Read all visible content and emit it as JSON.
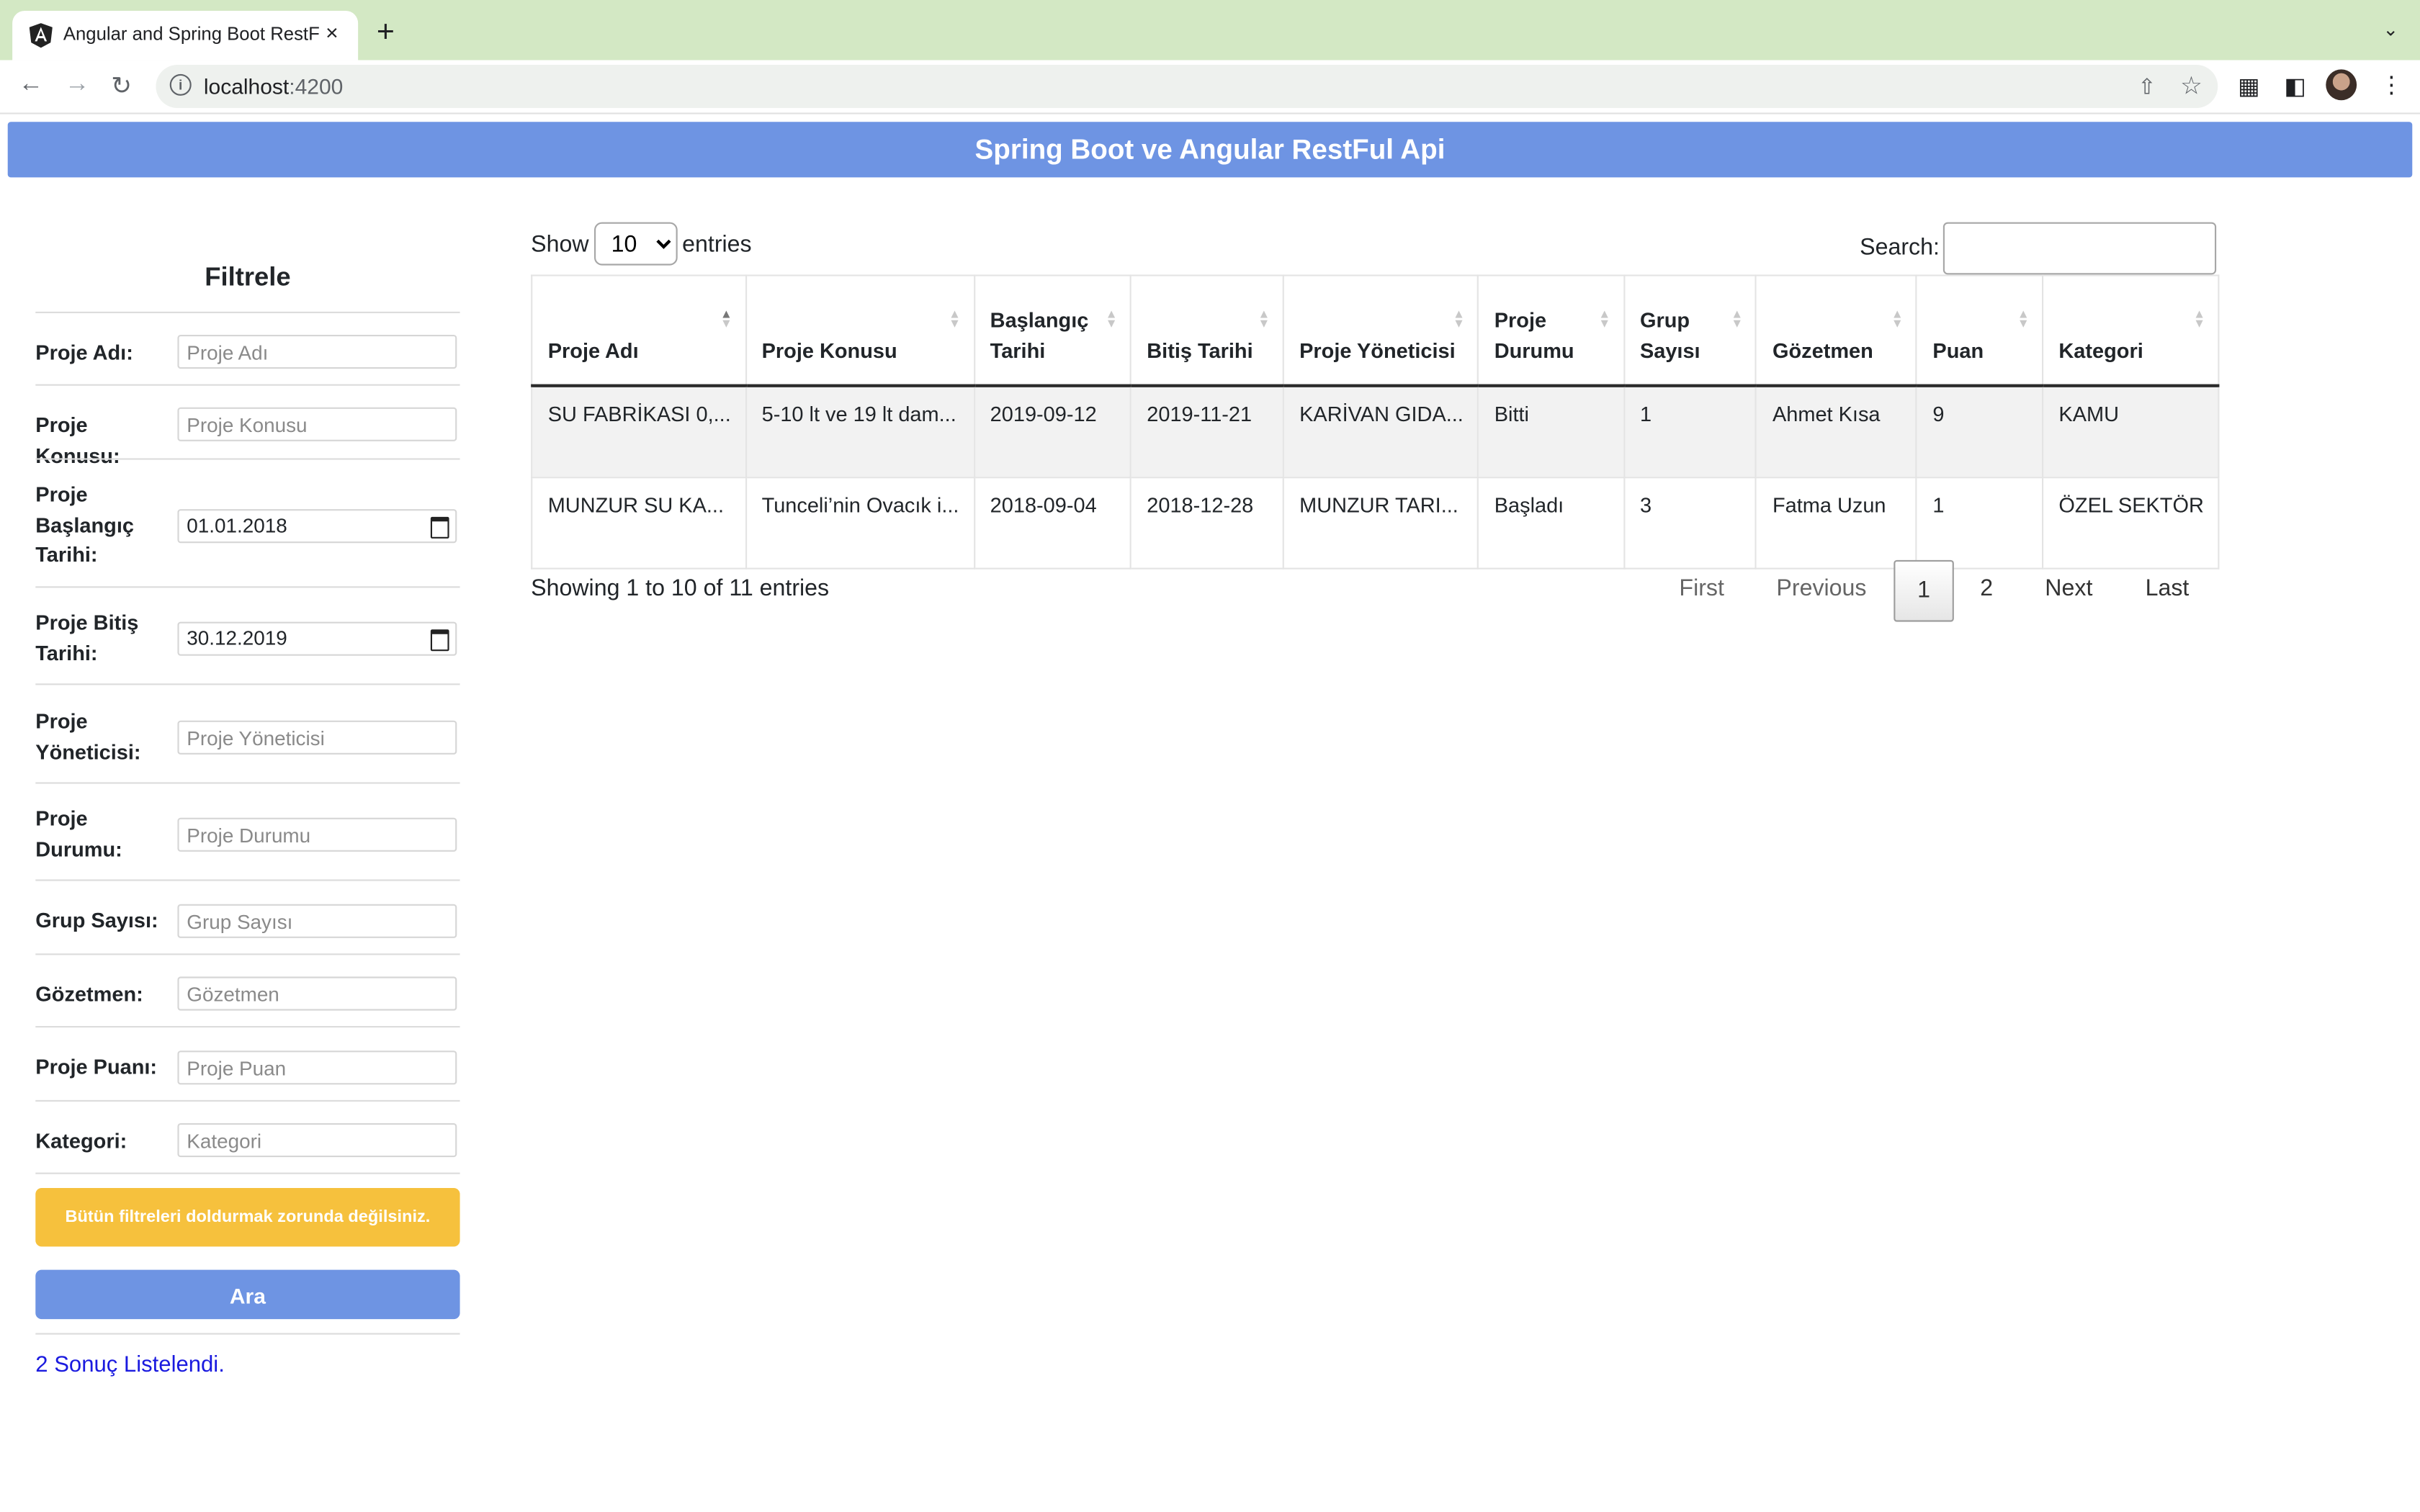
{
  "browser": {
    "tab_title": "Angular and Spring Boot RestF",
    "close_glyph": "×",
    "new_tab_glyph": "+",
    "url_host": "localhost",
    "url_port": ":4200"
  },
  "banner": {
    "title": "Spring Boot ve Angular RestFul Api"
  },
  "filter": {
    "title": "Filtrele",
    "fields": [
      {
        "label": "Proje Adı:",
        "placeholder": "Proje Adı"
      },
      {
        "label": "Proje Konusu:",
        "placeholder": "Proje Konusu"
      },
      {
        "label": "Proje Başlangıç Tarihi:",
        "value": "01.01.2018"
      },
      {
        "label": "Proje Bitiş Tarihi:",
        "value": "30.12.2019"
      },
      {
        "label": "Proje Yöneticisi:",
        "placeholder": "Proje Yöneticisi"
      },
      {
        "label": "Proje Durumu:",
        "placeholder": "Proje Durumu"
      },
      {
        "label": "Grup Sayısı:",
        "placeholder": "Grup Sayısı"
      },
      {
        "label": "Gözetmen:",
        "placeholder": "Gözetmen"
      },
      {
        "label": "Proje Puanı:",
        "placeholder": "Proje Puan"
      },
      {
        "label": "Kategori:",
        "placeholder": "Kategori"
      }
    ],
    "warning": "Bütün filtreleri doldurmak zorunda değilsiniz.",
    "search_button": "Ara",
    "result_text": "2 Sonuç Listelendi."
  },
  "table_controls": {
    "show_label": "Show",
    "page_size": "10",
    "entries_label": "entries",
    "search_label": "Search:"
  },
  "table": {
    "columns": [
      "Proje Adı",
      "Proje Konusu",
      "Başlangıç Tarihi",
      "Bitiş Tarihi",
      "Proje Yöneticisi",
      "Proje Durumu",
      "Grup Sayısı",
      "Gözetmen",
      "Puan",
      "Kategori"
    ],
    "rows": [
      [
        "SU FABRİKASI 0,...",
        "5-10 lt ve 19 lt dam...",
        "2019-09-12",
        "2019-11-21",
        "KARİVAN GIDA...",
        "Bitti",
        "1",
        "Ahmet Kısa",
        "9",
        "KAMU"
      ],
      [
        "MUNZUR SU KA...",
        "Tunceli’nin Ovacık i...",
        "2018-09-04",
        "2018-12-28",
        "MUNZUR TARI...",
        "Başladı",
        "3",
        "Fatma Uzun",
        "1",
        "ÖZEL SEKTÖR"
      ]
    ]
  },
  "pagination": {
    "info": "Showing 1 to 10 of 11 entries",
    "first": "First",
    "previous": "Previous",
    "page1": "1",
    "page2": "2",
    "next": "Next",
    "last": "Last"
  },
  "colors": {
    "banner": "#6e94e3",
    "warning": "#f6c13d",
    "button": "#6e94e3",
    "result_text": "#1a1adf",
    "tabstrip": "#d3e8c4"
  }
}
